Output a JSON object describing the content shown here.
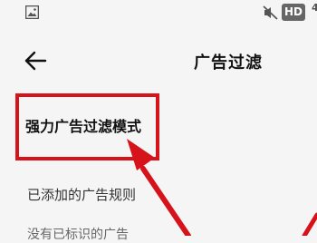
{
  "status_bar": {
    "hd_label": "HD",
    "signal_fragment": "4"
  },
  "header": {
    "title": "广告过滤"
  },
  "settings": {
    "strong_filter_label": "强力广告过滤模式"
  },
  "rules": {
    "section_title": "已添加的广告规则",
    "empty_text": "没有已标识的广告"
  },
  "colors": {
    "annotation_red": "#d6121b",
    "background": "#f5f5f5"
  }
}
